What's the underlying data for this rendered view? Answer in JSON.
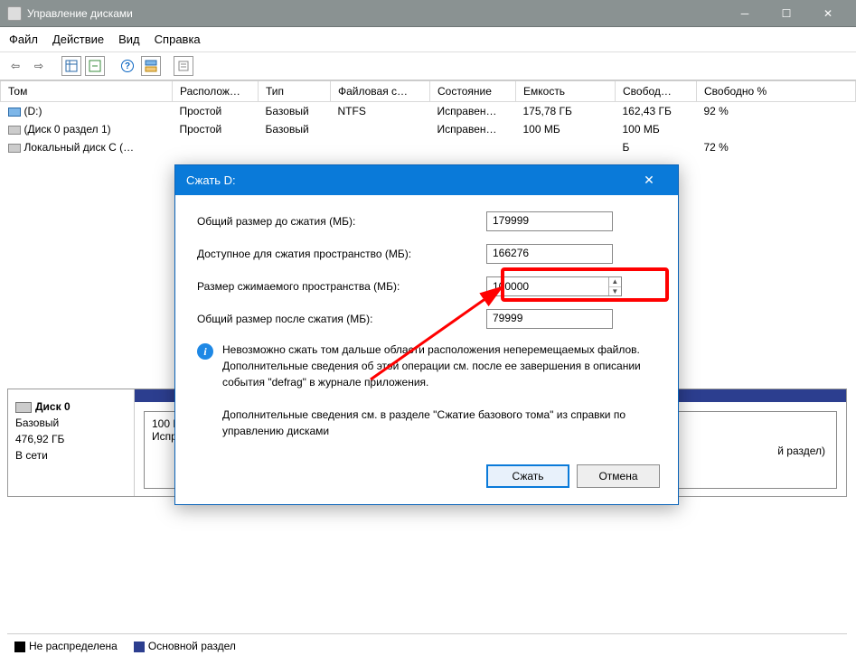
{
  "window": {
    "title": "Управление дисками"
  },
  "menu": {
    "file": "Файл",
    "action": "Действие",
    "view": "Вид",
    "help": "Справка"
  },
  "columns": {
    "volume": "Том",
    "layout": "Располож…",
    "type": "Тип",
    "fs": "Файловая с…",
    "status": "Состояние",
    "capacity": "Емкость",
    "free": "Свобод…",
    "free_pct": "Свободно %"
  },
  "rows": [
    {
      "name": "(D:)",
      "layout": "Простой",
      "type": "Базовый",
      "fs": "NTFS",
      "status": "Исправен…",
      "capacity": "175,78 ГБ",
      "free": "162,43 ГБ",
      "pct": "92 %"
    },
    {
      "name": "(Диск 0 раздел 1)",
      "layout": "Простой",
      "type": "Базовый",
      "fs": "",
      "status": "Исправен…",
      "capacity": "100 МБ",
      "free": "100 МБ",
      "pct": ""
    },
    {
      "name": "Локальный диск C (…",
      "layout": "",
      "type": "",
      "fs": "",
      "status": "",
      "capacity": "",
      "free": "Б",
      "pct": "72 %"
    }
  ],
  "disk": {
    "name": "Диск 0",
    "type": "Базовый",
    "size": "476,92 ГБ",
    "status": "В сети",
    "slice1_line1": "100 М",
    "slice1_line2": "Испра…",
    "slice2_suffix": "й раздел)"
  },
  "legend": {
    "unalloc": "Не распределена",
    "primary": "Основной раздел"
  },
  "dialog": {
    "title": "Сжать D:",
    "total_label": "Общий размер до сжатия (МБ):",
    "total_value": "179999",
    "avail_label": "Доступное для сжатия пространство (МБ):",
    "avail_value": "166276",
    "shrink_label": "Размер сжимаемого пространства (МБ):",
    "shrink_value": "100000",
    "after_label": "Общий размер после сжатия (МБ):",
    "after_value": "79999",
    "info": "Невозможно сжать том дальше области расположения неперемещаемых файлов. Дополнительные сведения об этой операции см. после ее завершения в описании события \"defrag\" в журнале приложения.",
    "extra": "Дополнительные сведения см. в разделе \"Сжатие базового тома\" из справки по управлению дисками",
    "ok": "Сжать",
    "cancel": "Отмена"
  }
}
